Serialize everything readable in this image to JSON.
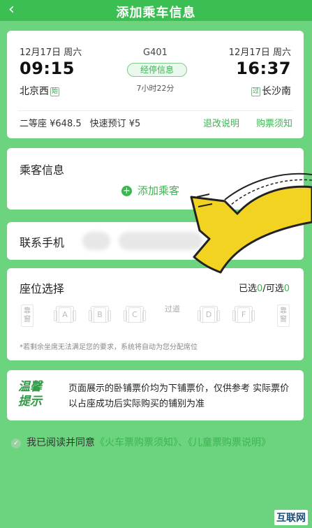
{
  "header": {
    "title": "添加乘车信息",
    "back_icon": "‹"
  },
  "trip": {
    "depart_date": "12月17日 周六",
    "depart_time": "09:15",
    "depart_station": "北京西",
    "depart_tag": "始",
    "train_no": "G401",
    "stops_label": "经停信息",
    "duration": "7小时22分",
    "arrive_date": "12月17日 周六",
    "arrive_time": "16:37",
    "arrive_station": "长沙南",
    "arrive_tag": "过",
    "seat_price": "二等座 ¥648.5",
    "fast_booking": "快速预订 ¥5",
    "refund_link": "退改说明",
    "notice_link": "购票须知"
  },
  "passenger": {
    "title": "乘客信息",
    "add_label": "添加乘客"
  },
  "contact": {
    "title": "联系手机"
  },
  "seat_select": {
    "title": "座位选择",
    "selected_prefix": "已选",
    "selected_count": "0",
    "sep": "/可选",
    "available_count": "0",
    "window_label": "靠窗",
    "aisle_label": "过道",
    "seats": [
      "A",
      "B",
      "C",
      "D",
      "F"
    ],
    "note": "*若剩余坐席无法满足您的要求，系统将自动为您分配席位"
  },
  "tip": {
    "badge": "温馨提示",
    "text": "页面展示的卧铺票价均为下铺票价，仅供参考 实际票价以占座成功后实际购买的铺别为准"
  },
  "agreement": {
    "prefix": "我已阅读并同意",
    "link1": "《火车票购票须知》",
    "sep": "、",
    "link2": "《儿童票购票说明》"
  },
  "watermark": "互联网",
  "colors": {
    "brand": "#3cbf52",
    "link": "#3cb552",
    "overlay_arrow": "#f2d321"
  }
}
